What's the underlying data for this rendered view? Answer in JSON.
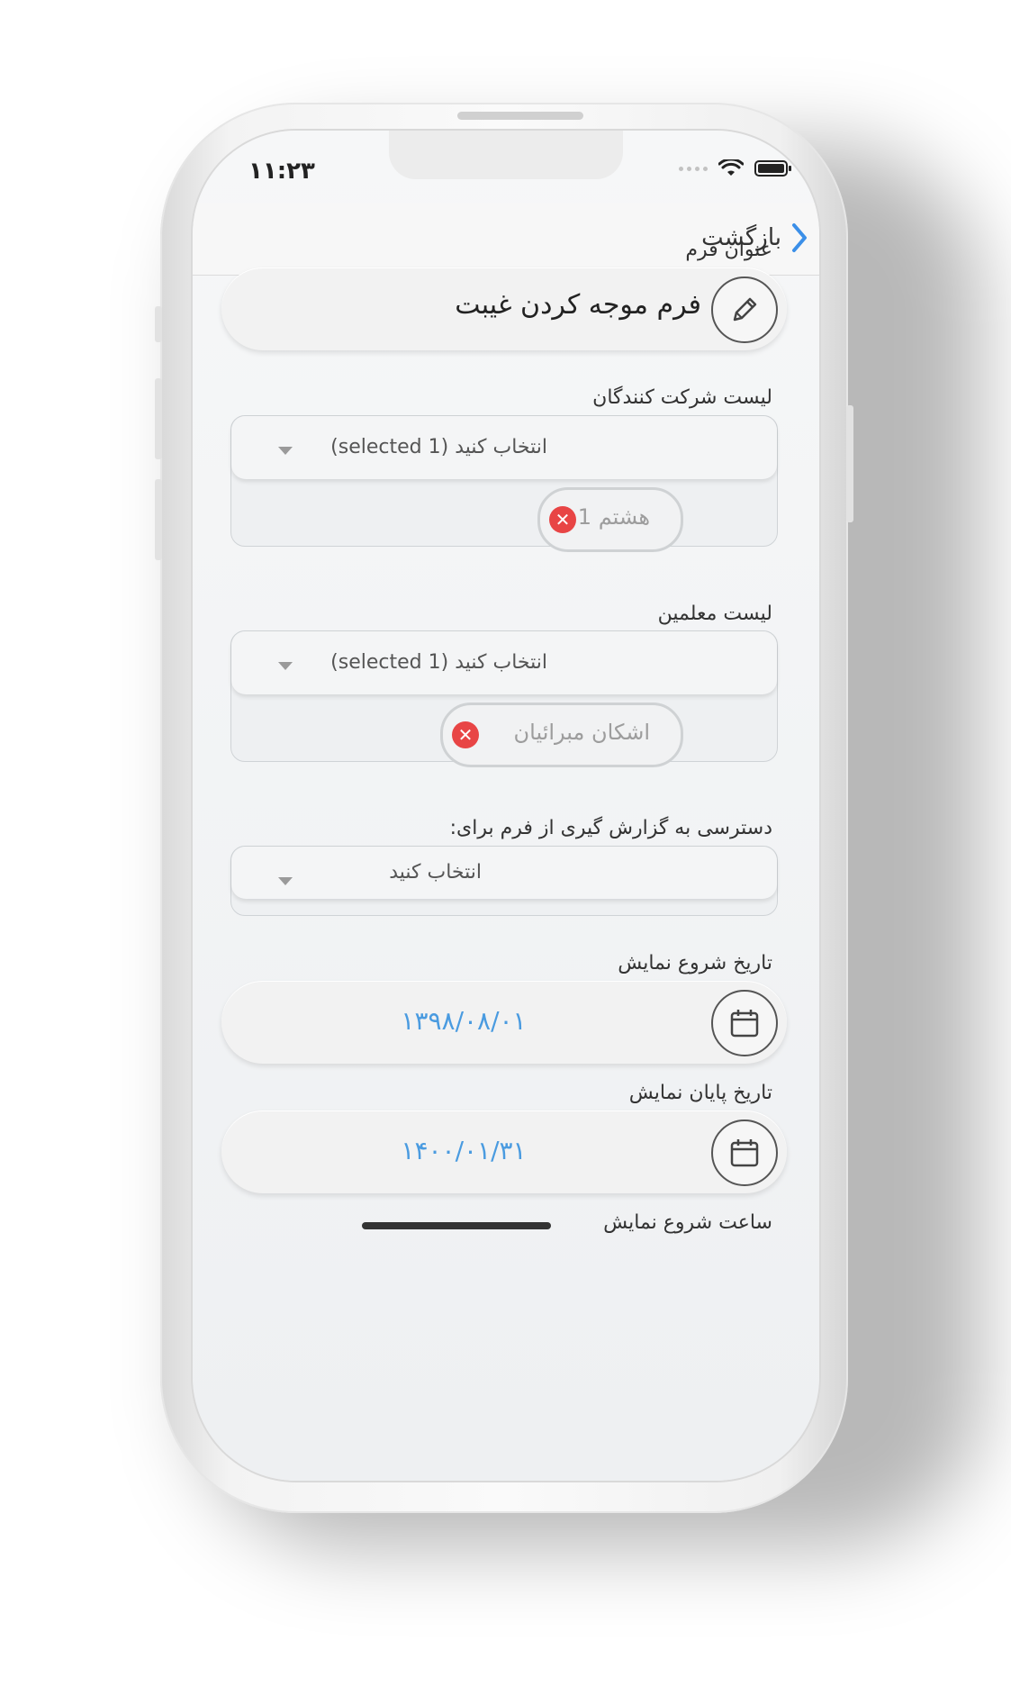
{
  "status_bar": {
    "time": "۱۱:۲۳"
  },
  "nav": {
    "back_label": "بازگشت"
  },
  "form_title": {
    "label": "عنوان فرم",
    "value": "فرم موجه کردن غیبت"
  },
  "participants": {
    "label": "لیست شرکت کنندگان",
    "select_text": "انتخاب کنید (1 selected)",
    "chips": [
      "هشتم 1"
    ]
  },
  "teachers": {
    "label": "لیست معلمین",
    "select_text": "انتخاب کنید (1 selected)",
    "chips": [
      "اشکان  مبرائیان"
    ]
  },
  "report_access": {
    "label": "دسترسی به گزارش گیری از فرم برای:",
    "select_text": "انتخاب کنید"
  },
  "start_date": {
    "label": "تاریخ شروع نمایش",
    "value": "۱۳۹۸/۰۸/۰۱"
  },
  "end_date": {
    "label": "تاریخ پایان نمایش",
    "value": "۱۴۰۰/۰۱/۳۱"
  },
  "start_time": {
    "label": "ساعت شروع نمایش"
  },
  "colors": {
    "accent": "#4a9be0",
    "chip_remove": "#e84545",
    "back_chevron": "#3b8fe8"
  },
  "icons": [
    "back-chevron-icon",
    "wifi-icon",
    "battery-icon",
    "pencil-icon",
    "calendar-icon",
    "caret-down-icon",
    "remove-chip-icon"
  ]
}
